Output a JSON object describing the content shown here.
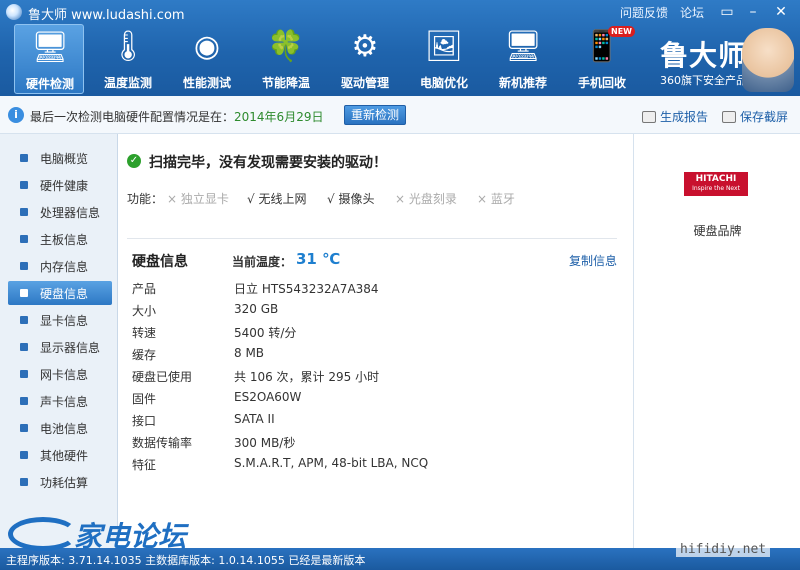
{
  "window": {
    "app_title": "鲁大师 www.ludashi.com",
    "links": [
      "问题反馈",
      "论坛"
    ],
    "controls": {
      "min": "–",
      "close": "✕"
    }
  },
  "toolbar": {
    "items": [
      {
        "label": "硬件检测",
        "icon": "🖥",
        "active": true
      },
      {
        "label": "温度监测",
        "icon": "🌡"
      },
      {
        "label": "性能测试",
        "icon": "◉"
      },
      {
        "label": "节能降温",
        "icon": "🍀"
      },
      {
        "label": "驱动管理",
        "icon": "⚙"
      },
      {
        "label": "电脑优化",
        "icon": "🖼"
      },
      {
        "label": "新机推荐",
        "icon": "🖥"
      },
      {
        "label": "手机回收",
        "icon": "📱",
        "badge": "NEW"
      }
    ],
    "brand": "鲁大师",
    "brand_sub": "360旗下安全产品"
  },
  "infobar": {
    "text": "最后一次检测电脑硬件配置情况是在：",
    "date": "2014年6月29日",
    "recheck": "重新检测",
    "report": "生成报告",
    "screenshot": "保存截屏"
  },
  "sidebar": {
    "items": [
      {
        "label": "电脑概览"
      },
      {
        "label": "硬件健康"
      },
      {
        "label": "处理器信息"
      },
      {
        "label": "主板信息"
      },
      {
        "label": "内存信息"
      },
      {
        "label": "硬盘信息",
        "active": true
      },
      {
        "label": "显卡信息"
      },
      {
        "label": "显示器信息"
      },
      {
        "label": "网卡信息"
      },
      {
        "label": "声卡信息"
      },
      {
        "label": "电池信息"
      },
      {
        "label": "其他硬件"
      },
      {
        "label": "功耗估算"
      }
    ]
  },
  "main": {
    "scan_message": "扫描完毕，没有发现需要安装的驱动！",
    "features_label": "功能：",
    "features": [
      {
        "label": "× 独立显卡",
        "available": false
      },
      {
        "label": "√ 无线上网",
        "available": true
      },
      {
        "label": "√ 摄像头",
        "available": true
      },
      {
        "label": "× 光盘刻录",
        "available": false
      },
      {
        "label": "× 蓝牙",
        "available": false
      }
    ],
    "section_title": "硬盘信息",
    "temp_label": "当前温度：",
    "temp_value": "31 ℃",
    "copy": "复制信息",
    "rows": [
      {
        "label": "产品",
        "value": "日立  HTS543232A7A384"
      },
      {
        "label": "大小",
        "value": "320 GB"
      },
      {
        "label": "转速",
        "value": "5400 转/分"
      },
      {
        "label": "缓存",
        "value": "8 MB"
      },
      {
        "label": "硬盘已使用",
        "value": "共 106 次，累计 295 小时"
      },
      {
        "label": "固件",
        "value": "ES2OA60W"
      },
      {
        "label": "接口",
        "value": "SATA II"
      },
      {
        "label": "数据传输率",
        "value": "300 MB/秒"
      },
      {
        "label": "特征",
        "value": "S.M.A.R.T,  APM,  48-bit LBA,  NCQ"
      }
    ]
  },
  "brand_panel": {
    "logo_name": "HITACHI",
    "logo_tag": "Inspire the Next",
    "caption": "硬盘品牌"
  },
  "footer": {
    "text": "主程序版本: 3.71.14.1035  主数据库版本: 1.0.14.1055    已经是最新版本"
  },
  "watermark": {
    "text": "家电论坛",
    "corner": "hifidiy.net"
  }
}
